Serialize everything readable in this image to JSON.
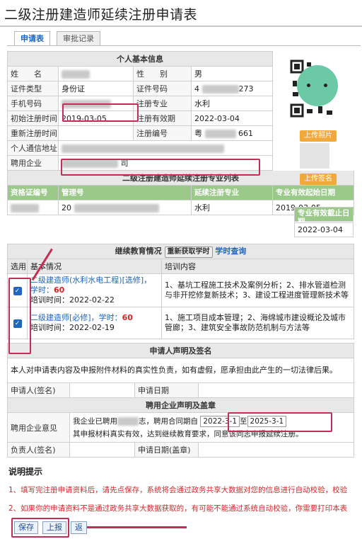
{
  "page": {
    "title": "二级注册建造师延续注册申请表",
    "tabs": [
      {
        "label": "申请表"
      },
      {
        "label": "审批记录"
      }
    ]
  },
  "personal": {
    "section": "个人基本信息",
    "name_label": "姓　　名",
    "gender_label": "性　　别",
    "gender_value": "男",
    "id_type_label": "证件类型",
    "id_type_value": "身份证",
    "id_no_label": "证件号码",
    "id_no_prefix": "4",
    "id_no_suffix": "273",
    "phone_label": "手机号码",
    "major_label": "注册专业",
    "major_value": "水利",
    "first_reg_label": "初始注册时间",
    "first_reg_value": "2019-03-05",
    "validity_label": "注册有效期",
    "validity_value": "2022-03-04",
    "rereg_label": "重新注册时间",
    "reg_no_label": "注册编号",
    "reg_no_prefix": "粤",
    "reg_no_suffix": "661",
    "address_label": "个人通信地址",
    "employer_label": "聘用企业",
    "employer_suffix": "司",
    "upload_photo": "上传照片",
    "upload_sign": "上传签名"
  },
  "majors": {
    "section": "二级注册建造师延续注册专业列表",
    "headers": [
      "资格证编号",
      "管理号",
      "延续注册专业",
      "专业有效起始日期",
      "专业有效截止日期"
    ],
    "row": {
      "cert_prefix": "",
      "mgmt_prefix": "20",
      "major": "水利",
      "start": "2019-03-05",
      "end": "2022-03-04"
    }
  },
  "education": {
    "section": "继续教育情况",
    "refresh_btn": "重新获取学时",
    "query_link": "学时查询",
    "col_select": "选用",
    "col_basic": "基本情况",
    "col_content": "培训内容",
    "items": [
      {
        "title_a": "二级建造师(水利水电工程)[选修]，学时：",
        "hours": "60",
        "time": "培训时间：2022-02-22",
        "content": "1、基坑工程施工技术及案例分析；2、排水管道检测与非开挖修复新技术；3、建设工程进度管理新技术等"
      },
      {
        "title_a": "二级建造师[必修]，学时：",
        "hours": "60",
        "time": "培训时间：2022-02-19",
        "content": "1、施工项目成本管理；2、海绵城市建设概论及城市管廊；3、建筑安全事故防范机制与方法等"
      }
    ]
  },
  "declaration": {
    "section": "申请人声明及签名",
    "text": "本人对申请表内容及申报附件材料的真实性负责，如有虚假，愿承担由此产生的一切法律后果。",
    "applicant_label": "申请人(签名)",
    "date_label": "申请日期"
  },
  "company": {
    "section": "聘用企业声明及盖章",
    "opinion_label": "聘用企业意见",
    "line1_a": "我企业已聘用",
    "line1_b": "志，聘用合同期自",
    "from_date": "2022-3-1",
    "to_label": "至",
    "to_date": "2025-3-1",
    "line2": "其申报材料真实有效，达到继续教育要求，同意该同志申报延续注册。",
    "leader_label": "负责人(签名)",
    "date_label": "申请日期(盖章)"
  },
  "notes": {
    "title": "说明提示",
    "items": [
      "1、填写完注册申请资料后，请先点保存，系统将会通过政务共享大数据对您的信息进行自动校验，校验",
      "2、如果你的申请资料不是通过政务共享大数据获取的，有可能不能通过系统自动校验，你需要打印本表"
    ]
  },
  "buttons": {
    "save": "保存",
    "submit": "上报",
    "back": "返"
  },
  "colors": {
    "highlight": "#c42e56",
    "header_green": "#9bc98a",
    "upload_orange": "#f2a93b",
    "link_blue": "#1e66c0",
    "note_red": "#d02b2b"
  }
}
